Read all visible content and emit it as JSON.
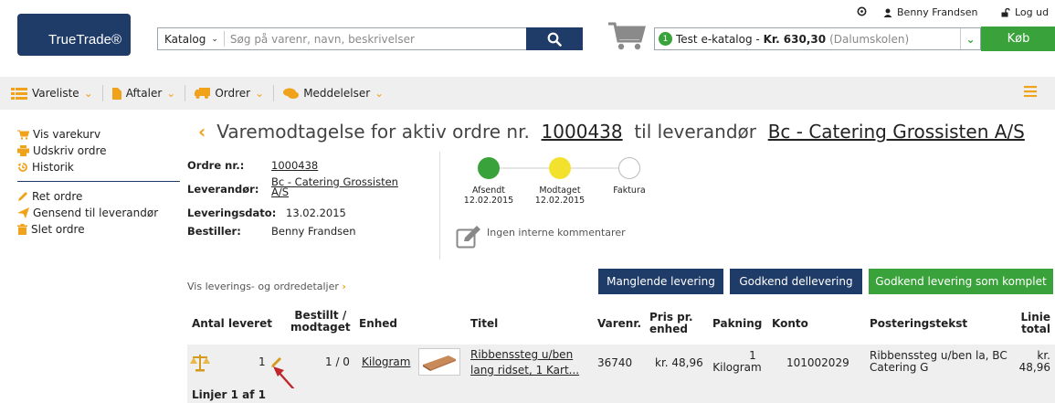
{
  "header": {
    "logo_text": "TrueTrade®",
    "search_category": "Katalog",
    "search_placeholder": "Søg på varenr, navn, beskrivelser",
    "catalog_count": "1",
    "catalog_name": "Test e-katalog - ",
    "catalog_amount": "Kr. 630,30",
    "catalog_org": "(Dalumskolen)",
    "buy_label": "Køb",
    "user_name": "Benny Frandsen",
    "logout_label": "Log ud"
  },
  "nav": {
    "items": [
      {
        "label": "Vareliste"
      },
      {
        "label": "Aftaler"
      },
      {
        "label": "Ordrer"
      },
      {
        "label": "Meddelelser"
      }
    ]
  },
  "sidebar": {
    "group1": [
      {
        "label": "Vis varekurv",
        "icon": "cart-icon"
      },
      {
        "label": "Udskriv ordre",
        "icon": "printer-icon"
      },
      {
        "label": "Historik",
        "icon": "history-icon"
      }
    ],
    "group2": [
      {
        "label": "Ret ordre",
        "icon": "pencil-icon"
      },
      {
        "label": "Gensend til leverandør",
        "icon": "send-icon"
      },
      {
        "label": "Slet ordre",
        "icon": "trash-icon"
      }
    ]
  },
  "page": {
    "title_prefix": "Varemodtagelse for aktiv ordre nr.",
    "order_no": "1000438",
    "title_mid": "til leverandør",
    "supplier": "Bc - Catering Grossisten A/S"
  },
  "details": {
    "order_label": "Ordre nr.:",
    "order_value": "1000438",
    "supplier_label": "Leverandør:",
    "supplier_line1": "Bc - Catering Grossisten",
    "supplier_line2": "A/S",
    "delivery_label": "Leveringsdato:",
    "delivery_value": "13.02.2015",
    "orderer_label": "Bestiller:",
    "orderer_value": "Benny Frandsen"
  },
  "steps": [
    {
      "label": "Afsendt",
      "date": "12.02.2015",
      "color": "#3aa23a"
    },
    {
      "label": "Modtaget",
      "date": "12.02.2015",
      "color": "#f2e22e"
    },
    {
      "label": "Faktura",
      "date": "",
      "color": "#ffffff"
    }
  ],
  "comment_text": "Ingen interne kommentarer",
  "details_link": "Vis leverings- og ordredetaljer",
  "buttons": {
    "missing": "Manglende levering",
    "partial": "Godkend dellevering",
    "complete": "Godkend levering som komplet"
  },
  "table": {
    "headers": {
      "qty": "Antal leveret",
      "ordered_l1": "Bestillt /",
      "ordered_l2": "modtaget",
      "unit": "Enhed",
      "title": "Titel",
      "itemno": "Varenr.",
      "price_l1": "Pris pr.",
      "price_l2": "enhed",
      "pack": "Pakning",
      "account": "Konto",
      "posting": "Posteringstekst",
      "total_l1": "Linie",
      "total_l2": "total"
    },
    "row": {
      "qty": "1",
      "ordered": "1 / 0",
      "unit": "Kilogram",
      "title_l1": "Ribbenssteg u/ben",
      "title_l2": "lang ridset, 1 Kart...",
      "itemno": "36740",
      "price": "kr. 48,96",
      "pack_l1": "1",
      "pack_l2": "Kilogram",
      "account": "101002029",
      "posting_l1": "Ribbenssteg u/ben la, BC",
      "posting_l2": "Catering G",
      "total_l1": "kr.",
      "total_l2": "48,96"
    },
    "footer": "Linjer 1 af 1"
  },
  "colors": {
    "navy": "#1f3b67",
    "green": "#3aa23a",
    "orange": "#f0a21a",
    "yellow": "#f2e22e"
  }
}
